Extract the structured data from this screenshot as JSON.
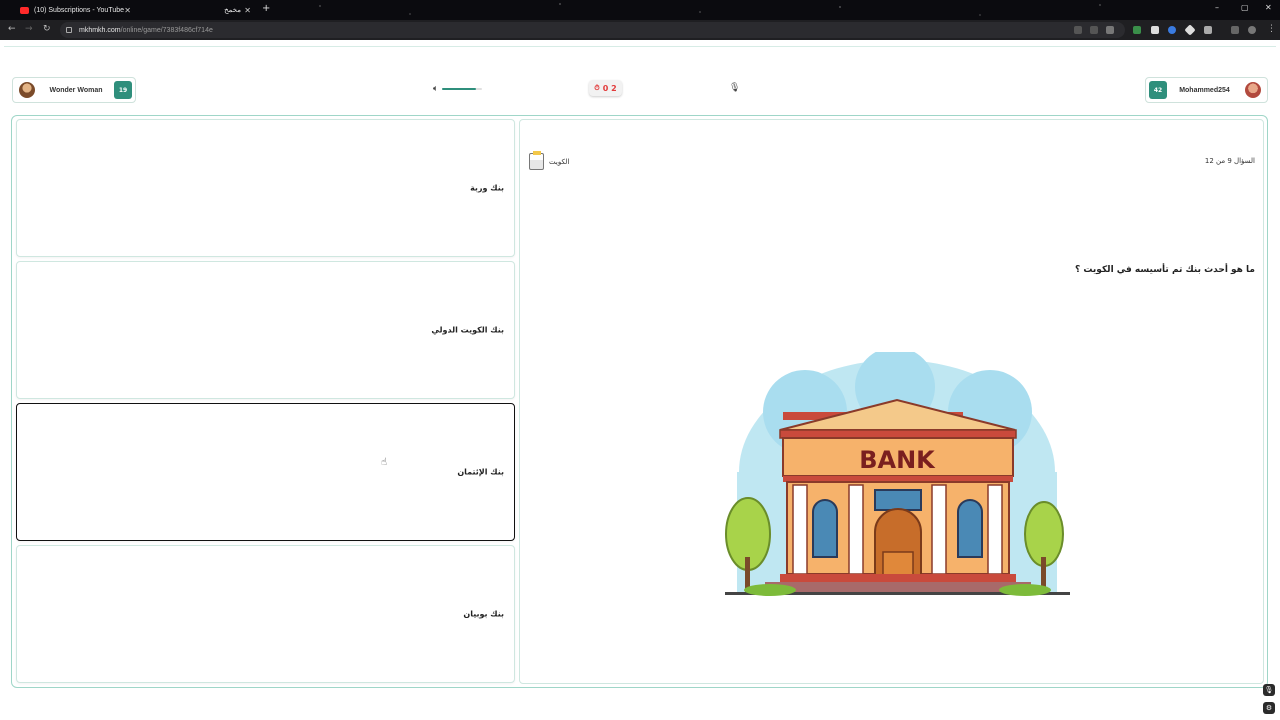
{
  "browser": {
    "tabs": [
      {
        "title": "(10) Subscriptions - YouTube",
        "active": true
      },
      {
        "title": "مخمخ",
        "active": false
      }
    ],
    "url_host": "mkhmkh.com",
    "url_path": "/online/game/7383f486cf714e",
    "window_controls": [
      "–",
      "▢",
      "✕"
    ]
  },
  "players": {
    "left": {
      "name": "Wonder Woman",
      "score": "19"
    },
    "right": {
      "name": "Mohammed254",
      "score": "42"
    }
  },
  "controls": {
    "volume_level": 0.85,
    "timer": "0 2"
  },
  "question": {
    "category": "الكويت",
    "counter": "السؤال 9 من 12",
    "text": "ما هو أحدث بنك تم تأسيسه في الكويت ؟",
    "image_label": "BANK"
  },
  "answers": [
    {
      "text": "بنك وربة",
      "selected": false
    },
    {
      "text": "بنك الكويت الدولي",
      "selected": false
    },
    {
      "text": "بنك الإئتمان",
      "selected": true
    },
    {
      "text": "بنك بوبيان",
      "selected": false
    }
  ],
  "colors": {
    "accent": "#2f8f7c",
    "board_border": "#9fd6c8",
    "timer": "#e23b3b"
  }
}
